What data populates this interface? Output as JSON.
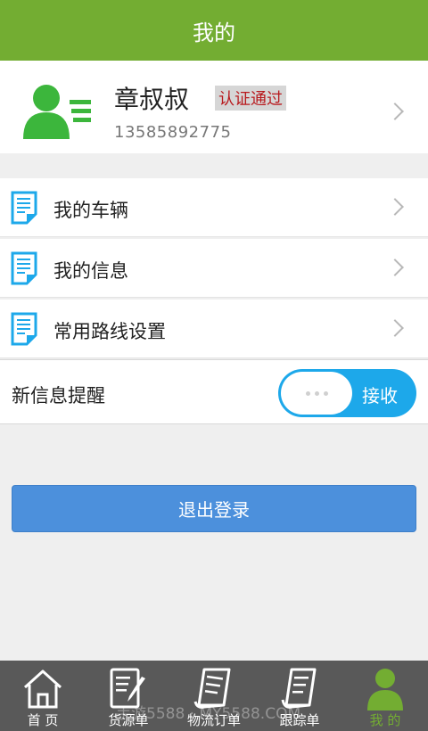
{
  "header": {
    "title": "我的"
  },
  "profile": {
    "name": "章叔叔",
    "verify_status": "认证通过",
    "phone": "13585892775"
  },
  "menu": [
    {
      "label": "我的车辆",
      "icon": "document-icon"
    },
    {
      "label": "我的信息",
      "icon": "document-icon"
    },
    {
      "label": "常用路线设置",
      "icon": "document-icon"
    }
  ],
  "notify": {
    "label": "新信息提醒",
    "toggle_text": "接收"
  },
  "logout": {
    "label": "退出登录"
  },
  "tabs": [
    {
      "label": "首 页",
      "icon": "home-icon"
    },
    {
      "label": "货源单",
      "icon": "edit-note-icon"
    },
    {
      "label": "物流订单",
      "icon": "order-icon"
    },
    {
      "label": "跟踪单",
      "icon": "tracking-icon"
    },
    {
      "label": "我 的",
      "icon": "user-icon",
      "active": true
    }
  ],
  "watermark": "手游5588 · MY5588.COM",
  "colors": {
    "brand_green": "#73ad32",
    "toggle_blue": "#1da8ea",
    "logout_blue": "#4c90dc",
    "verify_red": "#b8191d"
  }
}
